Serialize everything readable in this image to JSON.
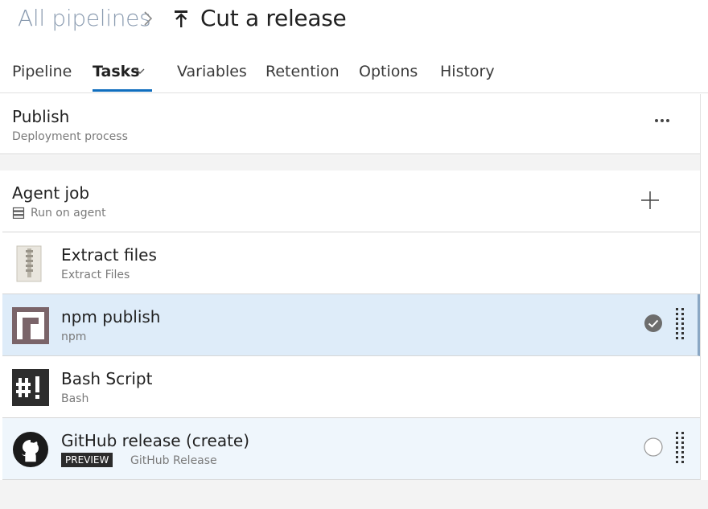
{
  "breadcrumb": {
    "parent": "All pipelines",
    "title": "Cut a release"
  },
  "tabs": [
    {
      "label": "Pipeline"
    },
    {
      "label": "Tasks"
    },
    {
      "label": "Variables"
    },
    {
      "label": "Retention"
    },
    {
      "label": "Options"
    },
    {
      "label": "History"
    }
  ],
  "active_tab": "Tasks",
  "stage": {
    "title": "Publish",
    "subtitle": "Deployment process"
  },
  "agent_job": {
    "title": "Agent job",
    "subtitle": "Run on agent"
  },
  "tasks": [
    {
      "title": "Extract files",
      "subtitle": "Extract Files",
      "icon": "zip-file-icon",
      "selected": false,
      "enabled": null
    },
    {
      "title": "npm publish",
      "subtitle": "npm",
      "icon": "npm-icon",
      "selected": true,
      "enabled": true
    },
    {
      "title": "Bash Script",
      "subtitle": "Bash",
      "icon": "bash-icon",
      "selected": false,
      "enabled": null
    },
    {
      "title": "GitHub release (create)",
      "subtitle": "GitHub Release",
      "badge": "PREVIEW",
      "icon": "github-icon",
      "selected": false,
      "enabled": false
    }
  ],
  "colors": {
    "accent": "#106ebe",
    "selected_row": "#deecf9",
    "hover_row": "#eff6fc",
    "npm_icon": "#7a6469"
  }
}
